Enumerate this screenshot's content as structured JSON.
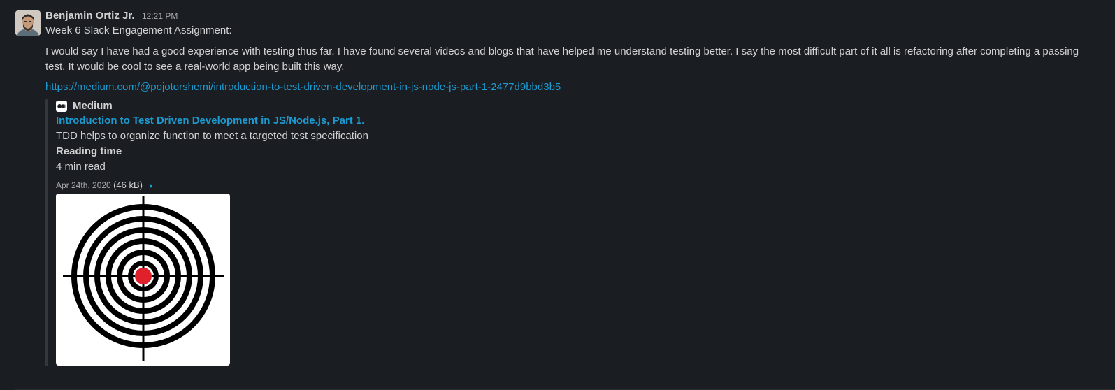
{
  "message": {
    "sender": "Benjamin Ortiz Jr.",
    "time": "12:21 PM",
    "title_line": "Week 6 Slack Engagement Assignment:",
    "paragraph": "I would say I have had a good experience with testing thus far. I have found several videos and blogs that have helped me understand testing better. I say the most difficult part of it all is refactoring after completing a passing test. It would be cool to see a real-world app being built this way.",
    "link": "https://medium.com/@pojotorshemi/introduction-to-test-driven-development-in-js-node-js-part-1-2477d9bbd3b5"
  },
  "attachment": {
    "service_name": "Medium",
    "service_icon": "medium-logo-icon",
    "title": "Introduction to Test Driven Development in JS/Node.js, Part 1.",
    "description": "TDD helps to organize function to meet a targeted test specification",
    "field_label": "Reading time",
    "field_value": "4 min read",
    "date": "Apr 24th, 2020",
    "size": "(46 kB)",
    "image": "target-image",
    "colors": {
      "link": "#1d9bd1",
      "bullseye": "#e0202a"
    }
  }
}
